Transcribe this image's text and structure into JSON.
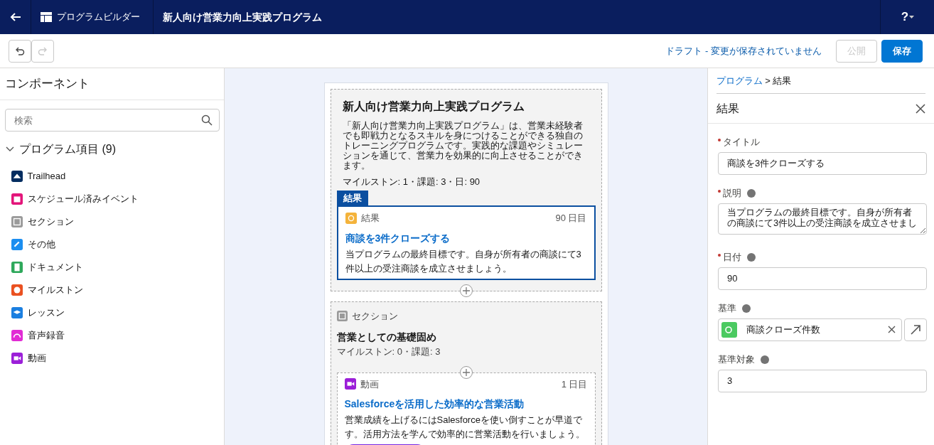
{
  "header": {
    "app": "プログラムビルダー",
    "title": "新人向け営業力向上実践プログラム",
    "help": "?"
  },
  "toolbar": {
    "undo_disabled": false,
    "redo_disabled": true,
    "status": "ドラフト - 変更が保存されていません",
    "buttons": [
      {
        "label": "公開",
        "kind": "neutral",
        "disabled": true
      },
      {
        "label": "保存",
        "kind": "brand",
        "disabled": false
      }
    ]
  },
  "sidebar": {
    "title": "コンポーネント",
    "search": {
      "placeholder": "検索"
    },
    "group": {
      "label": "プログラム項目 (9)",
      "expanded": true,
      "items": [
        {
          "label": "Trailhead",
          "kind": "trailhead",
          "color": "#032d60"
        },
        {
          "label": "スケジュール済みイベント",
          "kind": "event",
          "color": "#e3157a"
        },
        {
          "label": "セクション",
          "kind": "section",
          "color": "#9a9a9a"
        },
        {
          "label": "その他",
          "kind": "link",
          "color": "#1b8ef0"
        },
        {
          "label": "ドキュメント",
          "kind": "document",
          "color": "#2ea85b"
        },
        {
          "label": "マイルストン",
          "kind": "milestone",
          "color": "#ea5121"
        },
        {
          "label": "レッスン",
          "kind": "lesson",
          "color": "#1b7fe0"
        },
        {
          "label": "音声録音",
          "kind": "audio",
          "color": "#e12bd4"
        },
        {
          "label": "動画",
          "kind": "video",
          "color": "#9b1fd8"
        }
      ]
    }
  },
  "canvas": {
    "program": {
      "title": "新人向け営業力向上実践プログラム",
      "description": "「新人向け営業力向上実践プログラム」は、営業未経験者でも即戦力となるスキルを身につけることができる独自のトレーニングプログラムです。実践的な課題やシミュレーションを通じて、営業力を効果的に向上させることができます。",
      "stats": "マイルストン: 1・課題: 3・日: 90"
    },
    "items": [
      {
        "kind": "outcome",
        "color": "#f4b33b",
        "tab": "結果",
        "type_label": "結果",
        "day": "90 日目",
        "title": "商談を3件クローズする",
        "description": "当プログラムの最終目標です。自身が所有者の商談にて3件以上の受注商談を成立させましょう。",
        "selected": true
      }
    ],
    "section": {
      "type_label": "セクション",
      "title": "営業としての基礎固め",
      "stats": "マイルストン: 0・課題: 3",
      "items": [
        {
          "kind": "video",
          "color": "#9b1fd8",
          "type_label": "動画",
          "day": "1 日目",
          "title": "Salesforceを活用した効率的な営業活動",
          "description": "営業成績を上げるにはSalesforceを使い倒すことが早道です。活用方法を学んで効率的に営業活動を行いましょう。",
          "selected": false
        }
      ]
    }
  },
  "panel": {
    "breadcrumb": {
      "link": "プログラム",
      "current": "> 結果"
    },
    "title": "結果",
    "fields": [
      {
        "kind": "text",
        "label": "タイトル",
        "required": true,
        "info": false,
        "value": "商談を3件クローズする"
      },
      {
        "kind": "textarea",
        "label": "説明",
        "required": true,
        "info": true,
        "value": "当プログラムの最終目標です。自身が所有者の商談にて3件以上の受注商談を成立させまし"
      },
      {
        "kind": "text",
        "label": "日付",
        "required": true,
        "info": true,
        "value": "90"
      },
      {
        "kind": "lookup",
        "label": "基準",
        "required": false,
        "info": true,
        "value": "商談クローズ件数",
        "color": "#4bca61"
      },
      {
        "kind": "text",
        "label": "基準対象",
        "required": false,
        "info": true,
        "value": "3"
      }
    ]
  }
}
